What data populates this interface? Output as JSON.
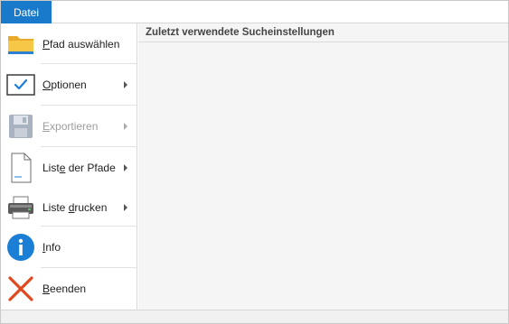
{
  "ribbon": {
    "file_tab_label": "Datei"
  },
  "menu": {
    "items": [
      {
        "label": "Pfad auswählen",
        "icon": "folder-icon",
        "has_submenu": false,
        "enabled": true
      },
      {
        "label": "Optionen",
        "icon": "checkmark-icon",
        "has_submenu": true,
        "enabled": true
      },
      {
        "label": "Exportieren",
        "icon": "floppy-disk-icon",
        "has_submenu": true,
        "enabled": false
      },
      {
        "label": "Liste der Pfade",
        "icon": "document-icon",
        "has_submenu": true,
        "enabled": true
      },
      {
        "label": "Liste drucken",
        "icon": "printer-icon",
        "has_submenu": true,
        "enabled": true
      },
      {
        "label": "Info",
        "icon": "info-icon",
        "has_submenu": false,
        "enabled": true
      },
      {
        "label": "Beenden",
        "icon": "close-x-icon",
        "has_submenu": false,
        "enabled": true
      }
    ]
  },
  "content": {
    "header": "Zuletzt verwendete Sucheinstellungen"
  },
  "colors": {
    "accent": "#1979ca",
    "exit_red": "#e0491f",
    "info_blue": "#1b7fd6",
    "folder_yellow": "#f5c242"
  }
}
